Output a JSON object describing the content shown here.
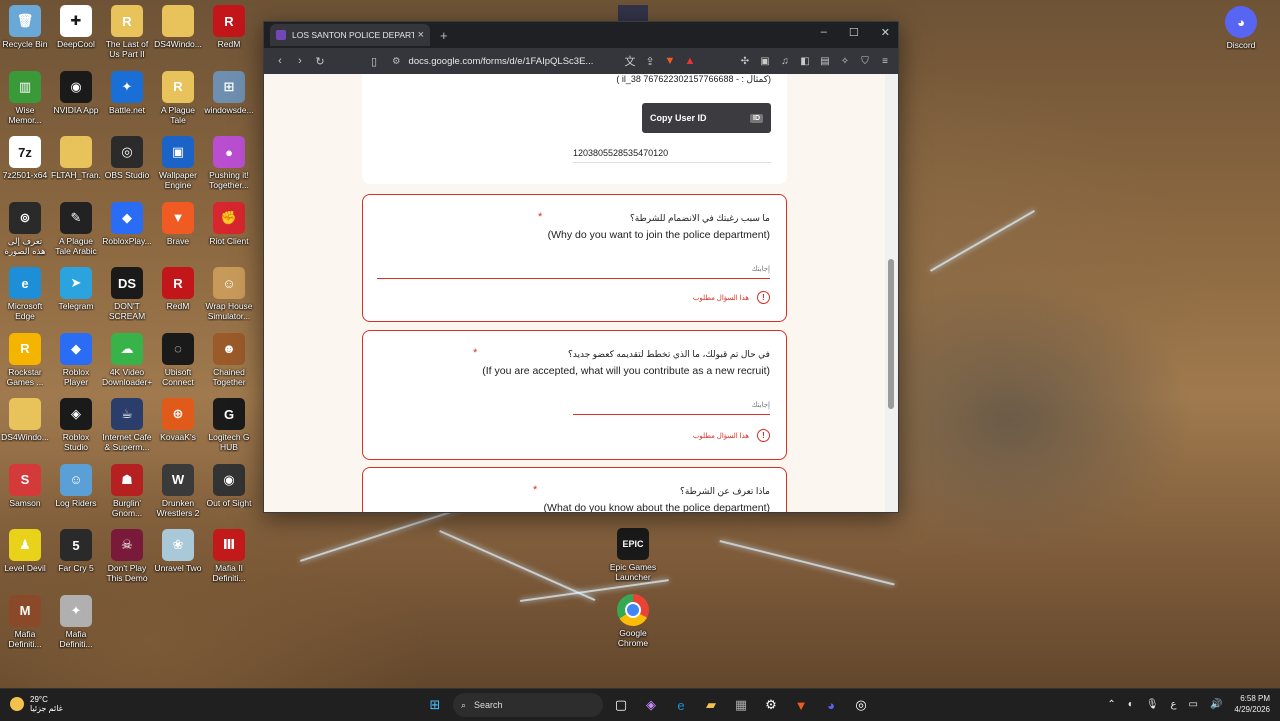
{
  "desktop_icons": [
    {
      "label": "Recycle Bin",
      "icon": "recycle-bin-icon",
      "color": "#6aa8d8",
      "glyph": "🗑",
      "col": 0,
      "row": 0
    },
    {
      "label": "DeepCool",
      "icon": "deepcool-icon",
      "color": "#ffffff",
      "glyph": "✚",
      "col": 1,
      "row": 0
    },
    {
      "label": "The Last of Us Part II",
      "icon": "folder-icon",
      "color": "#e8c25a",
      "glyph": "R",
      "col": 2,
      "row": 0
    },
    {
      "label": "DS4Windo...",
      "icon": "folder-icon",
      "color": "#e8c25a",
      "glyph": "",
      "col": 3,
      "row": 0
    },
    {
      "label": "RedM",
      "icon": "redm-icon",
      "color": "#c2161b",
      "glyph": "R",
      "col": 4,
      "row": 0
    },
    {
      "label": "Wise Memor...",
      "icon": "wise-memory-icon",
      "color": "#3a9a3a",
      "glyph": "▥",
      "col": 0,
      "row": 1
    },
    {
      "label": "NVIDIA App",
      "icon": "nvidia-icon",
      "color": "#1a1a1a",
      "glyph": "◉",
      "col": 1,
      "row": 1
    },
    {
      "label": "Battle.net",
      "icon": "battlenet-icon",
      "color": "#1a6fd6",
      "glyph": "✦",
      "col": 2,
      "row": 1
    },
    {
      "label": "A Plague Tale Innocence ...",
      "icon": "folder-icon",
      "color": "#e8c25a",
      "glyph": "R",
      "col": 3,
      "row": 1
    },
    {
      "label": "windowsde...",
      "icon": "windows-icon",
      "color": "#6f8fb0",
      "glyph": "⊞",
      "col": 4,
      "row": 1
    },
    {
      "label": "7z2501-x64",
      "icon": "7zip-icon",
      "color": "#ffffff",
      "glyph": "7z",
      "col": 0,
      "row": 2
    },
    {
      "label": "FLTAH_Tran...",
      "icon": "folder-icon",
      "color": "#e8c25a",
      "glyph": "",
      "col": 1,
      "row": 2
    },
    {
      "label": "OBS Studio",
      "icon": "obs-icon",
      "color": "#2b2b2b",
      "glyph": "◎",
      "col": 2,
      "row": 2
    },
    {
      "label": "Wallpaper Engine",
      "icon": "wallpaper-engine-icon",
      "color": "#1b63c6",
      "glyph": "▣",
      "col": 3,
      "row": 2
    },
    {
      "label": "Pushing it! Together...",
      "icon": "pushing-it-icon",
      "color": "#b94fd0",
      "glyph": "●",
      "col": 4,
      "row": 2
    },
    {
      "label": "تعرف إلى هذه الصورة",
      "icon": "spotlight-icon",
      "color": "#2a2a2a",
      "glyph": "⊚",
      "col": 0,
      "row": 3
    },
    {
      "label": "A Plague Tale Arabic",
      "icon": "plague-tale-arabic-icon",
      "color": "#222222",
      "glyph": "✎",
      "col": 1,
      "row": 3
    },
    {
      "label": "RobloxPlay...",
      "icon": "roblox-icon",
      "color": "#2a6df4",
      "glyph": "◆",
      "col": 2,
      "row": 3
    },
    {
      "label": "Brave",
      "icon": "brave-icon",
      "color": "#f05a23",
      "glyph": "▼",
      "col": 3,
      "row": 3
    },
    {
      "label": "Riot Client",
      "icon": "riot-icon",
      "color": "#d8262e",
      "glyph": "✊",
      "col": 4,
      "row": 3
    },
    {
      "label": "Microsoft Edge",
      "icon": "edge-icon",
      "color": "#1d8fd8",
      "glyph": "e",
      "col": 0,
      "row": 4
    },
    {
      "label": "Telegram",
      "icon": "telegram-icon",
      "color": "#2aa3df",
      "glyph": "➤",
      "col": 1,
      "row": 4
    },
    {
      "label": "DON'T SCREAM",
      "icon": "dont-scream-icon",
      "color": "#1a1a1a",
      "glyph": "DS",
      "col": 2,
      "row": 4
    },
    {
      "label": "RedM",
      "icon": "redm-icon",
      "color": "#c2161b",
      "glyph": "R",
      "col": 3,
      "row": 4
    },
    {
      "label": "Wrap House Simulator...",
      "icon": "wrap-house-icon",
      "color": "#c79a5a",
      "glyph": "☺",
      "col": 4,
      "row": 4
    },
    {
      "label": "Rockstar Games ...",
      "icon": "rockstar-icon",
      "color": "#f4b400",
      "glyph": "R",
      "col": 0,
      "row": 5
    },
    {
      "label": "Roblox Player",
      "icon": "roblox-icon",
      "color": "#2a6df4",
      "glyph": "◆",
      "col": 1,
      "row": 5
    },
    {
      "label": "4K Video Downloader+",
      "icon": "4k-video-icon",
      "color": "#37b34a",
      "glyph": "☁",
      "col": 2,
      "row": 5
    },
    {
      "label": "Ubisoft Connect",
      "icon": "ubisoft-icon",
      "color": "#1a1a1a",
      "glyph": "◌",
      "col": 3,
      "row": 5
    },
    {
      "label": "Chained Together",
      "icon": "chained-together-icon",
      "color": "#9a5a2a",
      "glyph": "☻",
      "col": 4,
      "row": 5
    },
    {
      "label": "DS4Windo...",
      "icon": "folder-icon",
      "color": "#e8c25a",
      "glyph": "",
      "col": 0,
      "row": 6
    },
    {
      "label": "Roblox Studio",
      "icon": "roblox-studio-icon",
      "color": "#1a1a1a",
      "glyph": "◈",
      "col": 1,
      "row": 6
    },
    {
      "label": "Internet Cafe & Superm...",
      "icon": "internet-cafe-icon",
      "color": "#2b3d6a",
      "glyph": "☕",
      "col": 2,
      "row": 6
    },
    {
      "label": "KovaaK's",
      "icon": "kovaaks-icon",
      "color": "#e05a1a",
      "glyph": "⊕",
      "col": 3,
      "row": 6
    },
    {
      "label": "Logitech G HUB",
      "icon": "logitech-icon",
      "color": "#1a1a1a",
      "glyph": "G",
      "col": 4,
      "row": 6
    },
    {
      "label": "Samson",
      "icon": "samson-icon",
      "color": "#d43a3a",
      "glyph": "S",
      "col": 0,
      "row": 7
    },
    {
      "label": "Log Riders",
      "icon": "log-riders-icon",
      "color": "#5aa0d6",
      "glyph": "☺",
      "col": 1,
      "row": 7
    },
    {
      "label": "Burglin' Gnom...",
      "icon": "burglin-gnomes-icon",
      "color": "#b52020",
      "glyph": "☗",
      "col": 2,
      "row": 7
    },
    {
      "label": "Drunken Wrestlers 2",
      "icon": "drunken-wrestlers-icon",
      "color": "#3a3a3a",
      "glyph": "W",
      "col": 3,
      "row": 7
    },
    {
      "label": "Out of Sight",
      "icon": "out-of-sight-icon",
      "color": "#333333",
      "glyph": "◉",
      "col": 4,
      "row": 7
    },
    {
      "label": "Level Devil",
      "icon": "level-devil-icon",
      "color": "#e8d21a",
      "glyph": "♟",
      "col": 0,
      "row": 8
    },
    {
      "label": "Far Cry 5",
      "icon": "far-cry-icon",
      "color": "#2a2a2a",
      "glyph": "5",
      "col": 1,
      "row": 8
    },
    {
      "label": "Don't Play This Demo",
      "icon": "dont-play-icon",
      "color": "#7a1a3a",
      "glyph": "☠",
      "col": 2,
      "row": 8
    },
    {
      "label": "Unravel Two",
      "icon": "unravel-icon",
      "color": "#a9c8d8",
      "glyph": "❀",
      "col": 3,
      "row": 8
    },
    {
      "label": "Mafia II Definiti...",
      "icon": "mafia-icon",
      "color": "#c21a1a",
      "glyph": "Ⅲ",
      "col": 4,
      "row": 8
    },
    {
      "label": "Mafia Definiti...",
      "icon": "mafia-icon",
      "color": "#8a4a2a",
      "glyph": "M",
      "col": 0,
      "row": 9
    },
    {
      "label": "Mafia Definiti...",
      "icon": "mafia-icon",
      "color": "#b0b0b0",
      "glyph": "✦",
      "col": 1,
      "row": 9
    }
  ],
  "extra_icons": [
    {
      "label": "Discord",
      "icon": "discord-icon",
      "color": "#5865f2",
      "glyph": "◕"
    },
    {
      "label": "Epic Games Launcher",
      "icon": "epic-games-icon",
      "color": "#1a1a1a",
      "glyph": "EPIC"
    },
    {
      "label": "Google Chrome",
      "icon": "chrome-icon",
      "color": "#34a853",
      "glyph": "◉"
    }
  ],
  "browser": {
    "tab_title": "LOS SANTON POLICE DEPARTME",
    "url": "docs.google.com/forms/d/e/1FAIpQLSc3E...",
    "controls": {
      "minimize": "–",
      "maximize": "☐",
      "close": "✕"
    }
  },
  "form": {
    "top_card": {
      "partial_text": "(كمثال : - il_38 767622302157766688 )",
      "copy_button": "Copy User ID",
      "user_id": "1203805528535470120"
    },
    "questions": [
      {
        "ar": "ما سبب رغبتك في الانضمام للشرطة؟",
        "en": "(Why do you want to join the police department)",
        "placeholder": "إجابتك",
        "error": "هذا السؤال مطلوب"
      },
      {
        "ar": "في حال تم قبولك، ما الذي تخطط لتقديمه كعضو جديد؟",
        "en": "(If you are accepted, what will you contribute as a new recruit)",
        "placeholder": "إجابتك",
        "error": "هذا السؤال مطلوب"
      },
      {
        "ar": "ماذا تعرف عن الشرطة؟",
        "en": "(What do you know about the police department)",
        "placeholder": "",
        "error": ""
      }
    ],
    "required_mark": "*",
    "help": "?"
  },
  "taskbar": {
    "temperature": "29°C",
    "weather_text": "غائم جزئيا",
    "search": "Search",
    "time": "6:58 PM",
    "date": "4/29/2026",
    "lang": "ع"
  }
}
